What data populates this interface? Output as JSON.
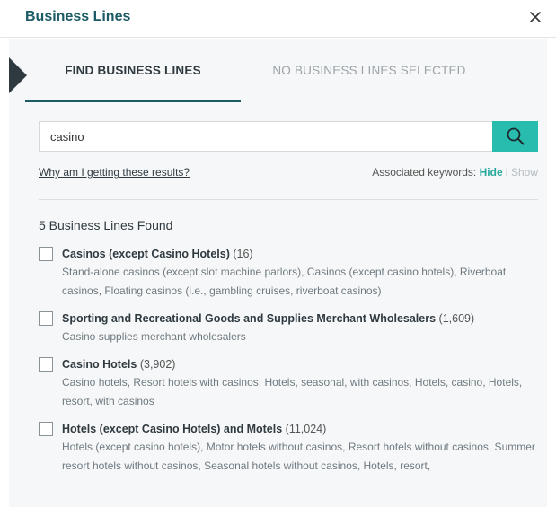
{
  "dialog": {
    "title": "Business Lines",
    "close_icon": "close-icon"
  },
  "tabs": {
    "find_label": "FIND BUSINESS LINES",
    "selected_label": "NO BUSINESS LINES SELECTED"
  },
  "search": {
    "value": "casino",
    "button_icon": "search-icon"
  },
  "info": {
    "why_link": "Why am I getting these results?",
    "keywords_label": "Associated keywords:",
    "hide_label": "Hide",
    "separator": "I",
    "show_label": "Show"
  },
  "results_header": "5 Business Lines Found",
  "results": [
    {
      "name": "Casinos (except Casino Hotels)",
      "count": "(16)",
      "description": "Stand-alone casinos (except slot machine parlors), Casinos (except casino hotels), Riverboat casinos, Floating casinos (i.e., gambling cruises, riverboat casinos)"
    },
    {
      "name": "Sporting and Recreational Goods and Supplies Merchant Wholesalers",
      "count": "(1,609)",
      "description": "Casino supplies merchant wholesalers"
    },
    {
      "name": "Casino Hotels",
      "count": "(3,902)",
      "description": "Casino hotels, Resort hotels with casinos, Hotels, seasonal, with casinos, Hotels, casino, Hotels, resort, with casinos"
    },
    {
      "name": "Hotels (except Casino Hotels) and Motels",
      "count": "(11,024)",
      "description": "Hotels (except casino hotels), Motor hotels without casinos, Resort hotels without casinos, Summer resort hotels without casinos, Seasonal hotels without casinos, Hotels, resort,"
    }
  ],
  "colors": {
    "title": "#1c5a66",
    "accent": "#27bcae",
    "link_active": "#27a89c",
    "panel_bg": "#f6f7f8"
  }
}
